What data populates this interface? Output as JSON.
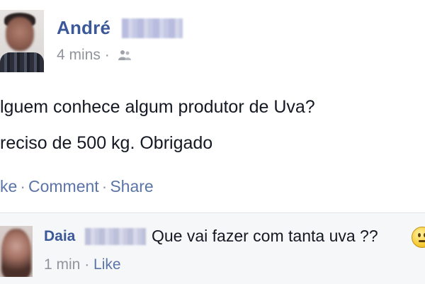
{
  "post": {
    "author_first_name": "André",
    "timestamp": "4 mins",
    "separator": "·",
    "audience_icon": "friends-icon",
    "text_lines": [
      "lguem conhece algum produtor de Uva?",
      "reciso de 500 kg. Obrigado"
    ],
    "actions": {
      "like_label": "ke",
      "comment_label": "Comment",
      "share_label": "Share",
      "separator": "·"
    }
  },
  "comment": {
    "author_first_name": "Daia",
    "text": "Que vai fazer com tanta uva ??",
    "emoji": "confused-face-emoji",
    "timestamp": "1 min",
    "separator": "·",
    "like_label": "Like"
  },
  "colors": {
    "link_blue": "#3b5998",
    "meta_gray": "#90949c",
    "action_blue": "#5b74a8",
    "text_dark": "#141823",
    "comment_bg": "#f6f7f9"
  }
}
